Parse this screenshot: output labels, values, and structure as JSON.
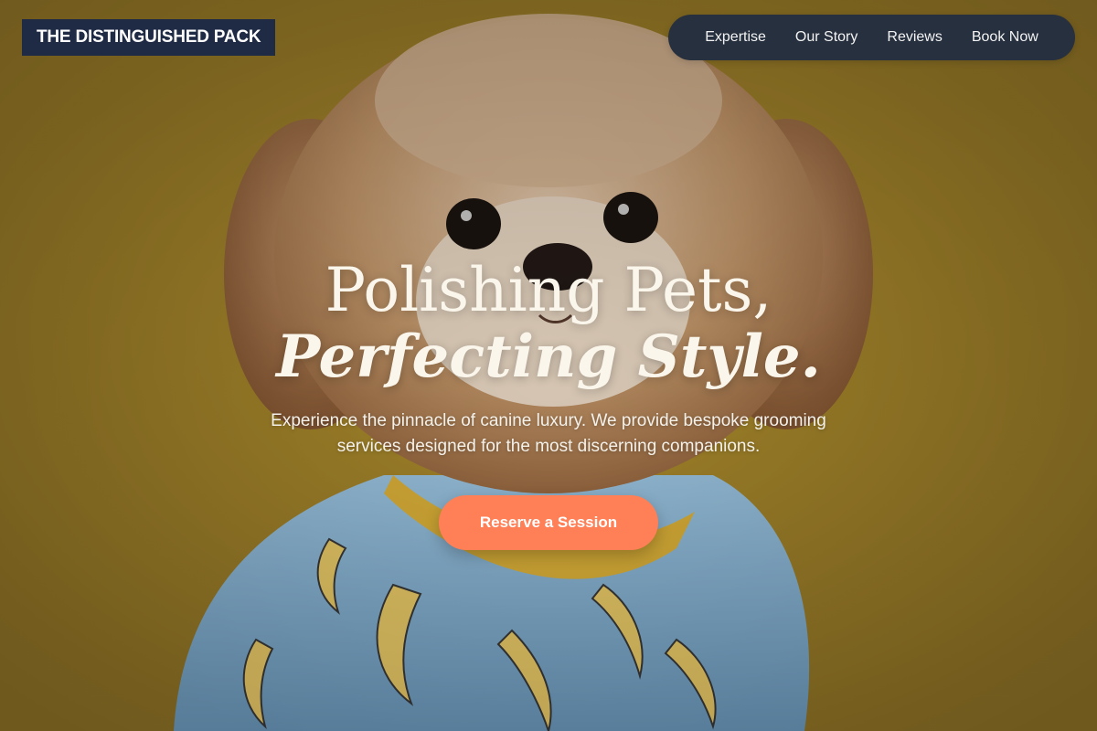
{
  "brand": {
    "name": "THE DISTINGUISHED PACK"
  },
  "nav": {
    "items": [
      {
        "label": "Expertise"
      },
      {
        "label": "Our Story"
      },
      {
        "label": "Reviews"
      },
      {
        "label": "Book Now"
      }
    ]
  },
  "hero": {
    "headline_line1": "Polishing Pets,",
    "headline_line2": "Perfecting Style.",
    "subtitle": "Experience the pinnacle of canine luxury. We provide bespoke grooming services designed for the most discerning companions.",
    "cta_label": "Reserve a Session",
    "image": "dog-in-banana-shirt-photo"
  },
  "colors": {
    "background": "#a8892c",
    "logo_bg": "#1f2a44",
    "nav_bg": "#27303f",
    "cta": "#ff7f56",
    "headline": "#fbf6ec"
  }
}
